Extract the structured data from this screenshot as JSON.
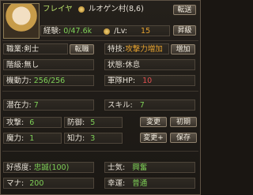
{
  "header": {
    "name": "フレイヤ",
    "location": "ルオゲン村(8,6)",
    "transfer_button": "転送",
    "exp_label": "経験:",
    "exp_value": "0/47.6k",
    "lv_label": "/Lv:",
    "lv_value": "15",
    "promote_button": "昇級"
  },
  "rows": {
    "job_label": "職業:剣士",
    "job_change_button": "転職",
    "skill_label": "特技:",
    "skill_value": "攻撃力増加",
    "skill_add_button": "増加",
    "rank_label": "階級:無し",
    "state_label": "状態:休息",
    "mobility_label": "機動力:",
    "mobility_value": "256/256",
    "army_hp_label": "軍隊HP:",
    "army_hp_value": "10",
    "potential_label": "潜在力:",
    "potential_value": "7",
    "skill_pt_label": "スキル:",
    "skill_pt_value": "7",
    "attack_label": "攻撃:",
    "attack_value": "6",
    "defense_label": "防御:",
    "defense_value": "5",
    "change_button": "変更",
    "init_button": "初期",
    "magic_label": "魔力:",
    "magic_value": "1",
    "intel_label": "知力:",
    "intel_value": "3",
    "change_plus_button": "変更+",
    "save_button": "保存",
    "favor_label": "好感度:",
    "favor_value": "忠誠(100)",
    "morale_label": "士気:",
    "morale_value": "興奮",
    "mana_label": "マナ:",
    "mana_value": "200",
    "luck_label": "幸運:",
    "luck_value": "普通"
  }
}
